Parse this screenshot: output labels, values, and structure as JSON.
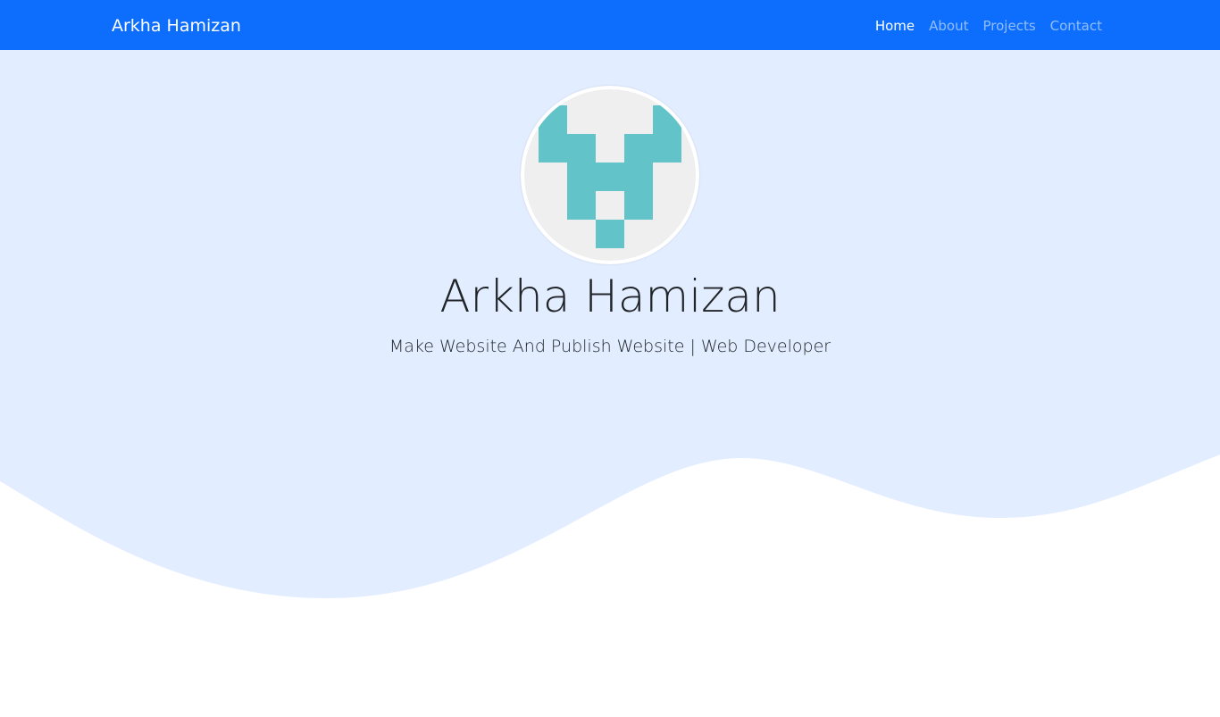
{
  "navbar": {
    "brand": "Arkha Hamizan",
    "links": [
      {
        "label": "Home",
        "active": true
      },
      {
        "label": "About",
        "active": false
      },
      {
        "label": "Projects",
        "active": false
      },
      {
        "label": "Contact",
        "active": false
      }
    ]
  },
  "hero": {
    "avatar_icon": "pixel-identicon",
    "name": "Arkha Hamizan",
    "tagline": "Make Website And Publish Website | Web Developer"
  },
  "colors": {
    "navbar": "#0d6efd",
    "hero_background": "#e2edff",
    "identicon": "#62c3c8",
    "avatar_background": "#efefef"
  }
}
